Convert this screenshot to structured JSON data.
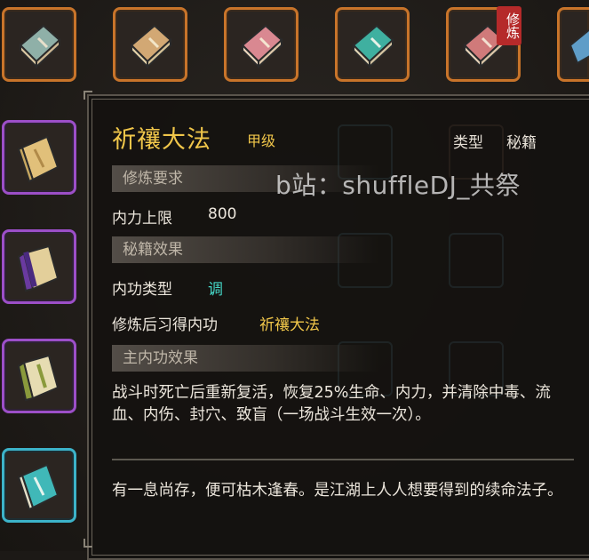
{
  "top_slots": [
    {
      "icon": "blue-green-book-icon",
      "color": "#8fb0a8"
    },
    {
      "icon": "tan-book-icon",
      "color": "#d2a874"
    },
    {
      "icon": "pink-book-icon",
      "color": "#d98891"
    },
    {
      "icon": "teal-book-icon",
      "color": "#3fb0a0"
    },
    {
      "icon": "red-book-icon",
      "color": "#d07a7a",
      "badge": "修炼"
    },
    {
      "icon": "blue-book-icon",
      "color": "#5f9dc8"
    }
  ],
  "side_slots": [
    {
      "icon": "tan-book-icon",
      "color": "#e1c07a",
      "rarity": "purple"
    },
    {
      "icon": "purple-book-icon",
      "color": "#6a3aa0",
      "rarity": "purple"
    },
    {
      "icon": "green-book-icon",
      "color": "#8a9a3c",
      "rarity": "purple"
    },
    {
      "icon": "teal-book-icon",
      "color": "#40b8b8",
      "rarity": "cyan"
    }
  ],
  "tooltip": {
    "title": "祈禳大法",
    "grade": "甲级",
    "type_label": "类型",
    "type_value": "秘籍",
    "requirements_header": "修炼要求",
    "requirement_label": "内力上限",
    "requirement_value": "800",
    "effect_header": "秘籍效果",
    "internal_type_label": "内功类型",
    "internal_type_value": "调",
    "learned_label": "修炼后习得内功",
    "learned_value": "祈禳大法",
    "main_effect_header": "主内功效果",
    "main_effect_text": "战斗时死亡后重新复活，恢复25%生命、内力，并清除中毒、流血、内伤、封穴、致盲（一场战斗生效一次）。",
    "flavor_text": "有一息尚存，便可枯木逢春。是江湖上人人想要得到的续命法子。"
  },
  "watermark": "b站：shuffleDJ_共祭",
  "colors": {
    "orange_border": "#c8742a",
    "purple_border": "#9c4fc8",
    "cyan_border": "#3cb3c9",
    "gold_text": "#f0c64a",
    "cyan_text": "#45d8c8"
  }
}
